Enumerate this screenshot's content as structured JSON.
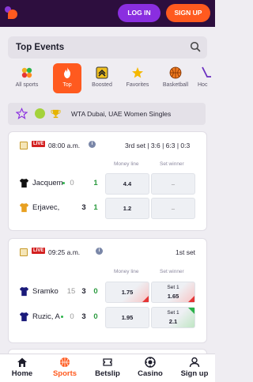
{
  "header": {
    "login_label": "LOG IN",
    "signup_label": "SIGN UP"
  },
  "top_events": {
    "title": "Top Events"
  },
  "categories": [
    {
      "label": "All sports",
      "icon": "all-sports-icon"
    },
    {
      "label": "Top",
      "icon": "fire-icon",
      "active": true
    },
    {
      "label": "Boosted",
      "icon": "boost-icon"
    },
    {
      "label": "Favorites",
      "icon": "star-icon"
    },
    {
      "label": "Basketball",
      "icon": "basketball-icon"
    },
    {
      "label": "Hoc",
      "icon": "hockey-icon"
    }
  ],
  "league": {
    "name": "WTA Dubai, UAE Women Singles"
  },
  "match1": {
    "live": "LIVE",
    "time": "08:00 a.m.",
    "set_info": "3rd set  |  3:6  |  6:3  |  0:3",
    "col_money": "Money line",
    "col_set": "Set winner",
    "p1": {
      "name": "Jacquem",
      "s1": "0",
      "s2": "1",
      "odd": "4.4",
      "set": "–"
    },
    "p2": {
      "name": "Erjavec,",
      "s1": "3",
      "s2": "1",
      "odd": "1.2",
      "set": "–"
    }
  },
  "match2": {
    "live": "LIVE",
    "time": "09:25 a.m.",
    "set_info": "1st set",
    "col_money": "Money line",
    "col_set": "Set winner",
    "p1": {
      "name": "Sramko",
      "s0": "15",
      "s1": "3",
      "s2": "0",
      "odd": "1.75",
      "set_label": "Set 1",
      "set": "1.65"
    },
    "p2": {
      "name": "Ruzic, A",
      "s0": "0",
      "s1": "3",
      "s2": "0",
      "odd": "1.95",
      "set_label": "Set 1",
      "set": "2.1"
    }
  },
  "nav": {
    "home": "Home",
    "sports": "Sports",
    "betslip": "Betslip",
    "casino": "Casino",
    "signup": "Sign up"
  },
  "colors": {
    "brand_dark": "#2d0e3e",
    "login": "#8a2ee0",
    "accent": "#ff5a1f",
    "live": "#d32020"
  }
}
